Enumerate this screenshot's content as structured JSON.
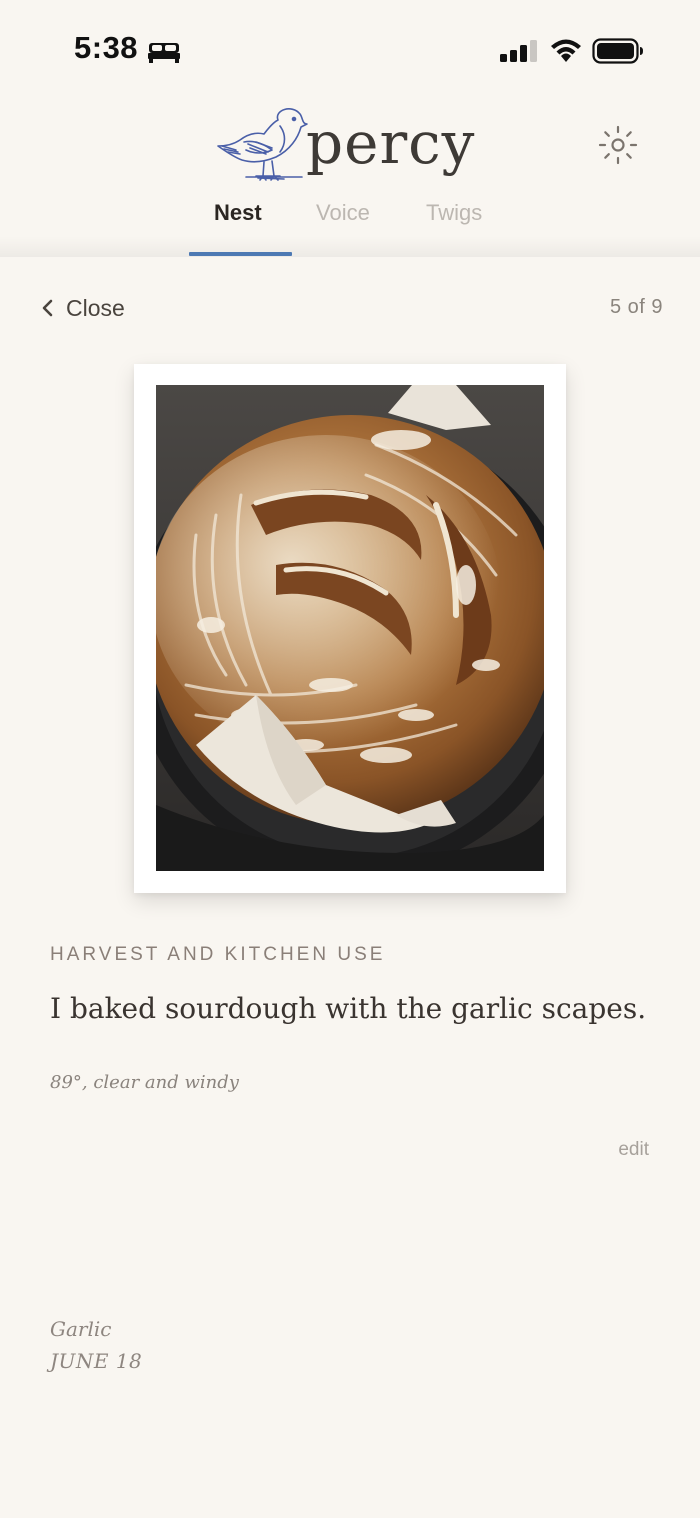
{
  "status_bar": {
    "time": "5:38",
    "icons": [
      "bed-icon",
      "cellular-signal-icon",
      "wifi-icon",
      "battery-icon"
    ]
  },
  "header": {
    "logo_text": "percy",
    "logo_icon": "bird-logo-icon",
    "settings_icon": "sun-settings-icon"
  },
  "tabs": [
    {
      "label": "Nest",
      "active": true
    },
    {
      "label": "Voice",
      "active": false
    },
    {
      "label": "Twigs",
      "active": false
    }
  ],
  "entry_view": {
    "close_label": "Close",
    "pager": "5 of 9",
    "category": "HARVEST AND KITCHEN USE",
    "text": "I baked sourdough with the garlic scapes.",
    "weather": "89°, clear and windy",
    "edit_label": "edit",
    "plant": "Garlic",
    "date": "JUNE 18"
  },
  "colors": {
    "background": "#f9f6f1",
    "accent": "#4d79b3",
    "logo_bird": "#4a5fa8"
  }
}
